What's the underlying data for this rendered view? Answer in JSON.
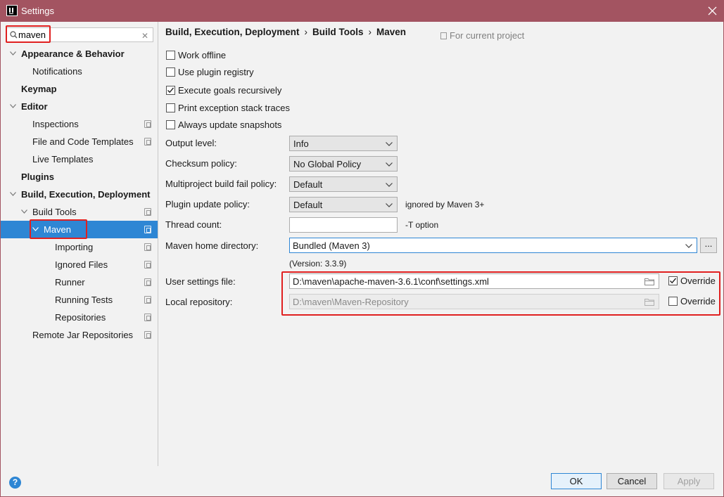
{
  "window": {
    "title": "Settings"
  },
  "search": {
    "value": "maven",
    "clear_icon": "close-icon"
  },
  "sidebar": {
    "items": [
      {
        "label": "Appearance & Behavior"
      },
      {
        "label": "Notifications"
      },
      {
        "label": "Keymap"
      },
      {
        "label": "Editor"
      },
      {
        "label": "Inspections"
      },
      {
        "label": "File and Code Templates"
      },
      {
        "label": "Live Templates"
      },
      {
        "label": "Plugins"
      },
      {
        "label": "Build, Execution, Deployment"
      },
      {
        "label": "Build Tools"
      },
      {
        "label": "Maven"
      },
      {
        "label": "Importing"
      },
      {
        "label": "Ignored Files"
      },
      {
        "label": "Runner"
      },
      {
        "label": "Running Tests"
      },
      {
        "label": "Repositories"
      },
      {
        "label": "Remote Jar Repositories"
      }
    ],
    "selected": "Maven"
  },
  "breadcrumb": {
    "items": [
      "Build, Execution, Deployment",
      "Build Tools",
      "Maven"
    ],
    "separator": "›",
    "scope_label": "For current project"
  },
  "options": {
    "work_offline": {
      "label": "Work offline",
      "checked": false
    },
    "use_plugin_registry": {
      "label": "Use plugin registry",
      "checked": false
    },
    "execute_goals_recursively": {
      "label": "Execute goals recursively",
      "checked": true
    },
    "print_exception_stack_traces": {
      "label": "Print exception stack traces",
      "checked": false
    },
    "always_update_snapshots": {
      "label": "Always update snapshots",
      "checked": false
    }
  },
  "fields": {
    "output_level": {
      "label": "Output level:",
      "value": "Info"
    },
    "checksum_policy": {
      "label": "Checksum policy:",
      "value": "No Global Policy"
    },
    "multiproject_fail_policy": {
      "label": "Multiproject build fail policy:",
      "value": "Default"
    },
    "plugin_update_policy": {
      "label": "Plugin update policy:",
      "value": "Default",
      "hint": "ignored by Maven 3+"
    },
    "thread_count": {
      "label": "Thread count:",
      "value": "",
      "hint": "-T option"
    },
    "maven_home": {
      "label": "Maven home directory:",
      "value": "Bundled (Maven 3)",
      "browse_label": "...",
      "version": "(Version: 3.3.9)"
    },
    "user_settings": {
      "label": "User settings file:",
      "value": "D:\\maven\\apache-maven-3.6.1\\conf\\settings.xml",
      "override_label": "Override",
      "override": true
    },
    "local_repository": {
      "label": "Local repository:",
      "value": "D:\\maven\\Maven-Repository",
      "override_label": "Override",
      "override": false
    }
  },
  "footer": {
    "help_label": "?",
    "ok_label": "OK",
    "cancel_label": "Cancel",
    "apply_label": "Apply"
  },
  "colors": {
    "titlebar": "#a35461",
    "selection": "#2e86d4",
    "highlight_box": "#e02020"
  }
}
